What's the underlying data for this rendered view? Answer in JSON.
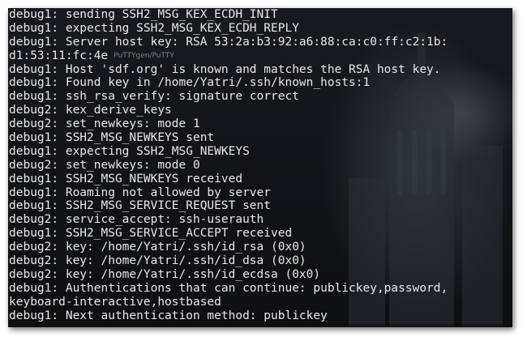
{
  "terminal": {
    "lines": [
      "debug1: sending SSH2_MSG_KEX_ECDH_INIT",
      "debug1: expecting SSH2_MSG_KEX_ECDH_REPLY",
      "debug1: Server host key: RSA 53:2a:b3:92:a6:88:ca:c0:ff:c2:1b:",
      "d1:53:11:fc:4e",
      "debug1: Host 'sdf.org' is known and matches the RSA host key.",
      "debug1: Found key in /home/Yatri/.ssh/known_hosts:1",
      "debug1: ssh_rsa_verify: signature correct",
      "debug2: kex_derive_keys",
      "debug2: set_newkeys: mode 1",
      "debug1: SSH2_MSG_NEWKEYS sent",
      "debug1: expecting SSH2_MSG_NEWKEYS",
      "debug2: set_newkeys: mode 0",
      "debug1: SSH2_MSG_NEWKEYS received",
      "debug1: Roaming not allowed by server",
      "debug1: SSH2_MSG_SERVICE_REQUEST sent",
      "debug2: service_accept: ssh-userauth",
      "debug1: SSH2_MSG_SERVICE_ACCEPT received",
      "debug2: key: /home/Yatri/.ssh/id_rsa (0x0)",
      "debug2: key: /home/Yatri/.ssh/id_dsa (0x0)",
      "debug2: key: /home/Yatri/.ssh/id_ecdsa (0x0)",
      "debug1: Authentications that can continue: publickey,password,",
      "keyboard-interactive,hostbased",
      "debug1: Next authentication method: publickey"
    ],
    "overlay_text": "PuTTYgen/PuTTY"
  },
  "colors": {
    "text": "#e8e8e8",
    "background": "#121417"
  }
}
